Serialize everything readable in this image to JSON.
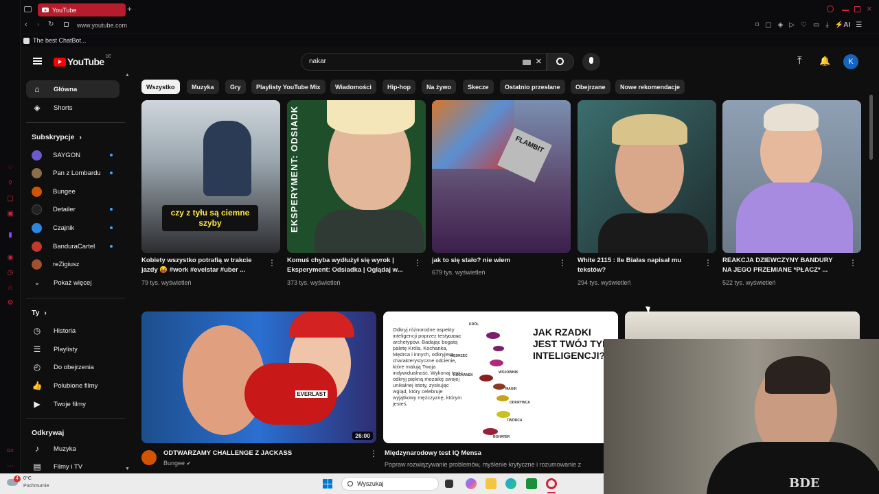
{
  "browser": {
    "tab_title": "YouTube",
    "url": "www.youtube.com",
    "bookmark": "The best ChatBot...",
    "ai_label": "AI"
  },
  "youtube": {
    "logo": "YouTube",
    "region": "DE",
    "search_value": "nakar",
    "avatar_letter": "K"
  },
  "sidebar": {
    "main": [
      {
        "label": "Główna",
        "icon": "home-icon"
      },
      {
        "label": "Shorts",
        "icon": "shorts-icon"
      }
    ],
    "subscriptions_title": "Subskrypcje",
    "subscriptions": [
      {
        "label": "SAYGON",
        "color": "#6a5acd",
        "dot": true
      },
      {
        "label": "Pan z Lombardu",
        "color": "#8b6f47",
        "dot": true
      },
      {
        "label": "Bungee",
        "color": "#d35400",
        "dot": false
      },
      {
        "label": "Detailer",
        "color": "#222222",
        "dot": true
      },
      {
        "label": "Czajnik",
        "color": "#2e86de",
        "dot": true
      },
      {
        "label": "BanduraCartel",
        "color": "#c0392b",
        "dot": true
      },
      {
        "label": "reZigiusz",
        "color": "#a0522d",
        "dot": false
      }
    ],
    "show_more": "Pokaż więcej",
    "you_title": "Ty",
    "you_items": [
      {
        "label": "Historia",
        "icon": "history-icon"
      },
      {
        "label": "Playlisty",
        "icon": "playlist-icon"
      },
      {
        "label": "Do obejrzenia",
        "icon": "watch-later-icon"
      },
      {
        "label": "Polubione filmy",
        "icon": "like-icon"
      },
      {
        "label": "Twoje filmy",
        "icon": "your-videos-icon"
      }
    ],
    "explore_title": "Odkrywaj",
    "explore_items": [
      {
        "label": "Muzyka",
        "icon": "music-icon"
      },
      {
        "label": "Filmy i TV",
        "icon": "film-icon"
      }
    ]
  },
  "chips": [
    "Wszystko",
    "Muzyka",
    "Gry",
    "Playlisty YouTube Mix",
    "Wiadomości",
    "Hip-hop",
    "Na żywo",
    "Skecze",
    "Ostatnio przesłane",
    "Obejrzane",
    "Nowe rekomendacje"
  ],
  "row1": [
    {
      "title1": "Kobiety wszystko potrafią w trakcie",
      "title2": "jazdy 😝 #work #evelstar #uber ...",
      "views": "79 tys. wyświetleń",
      "caption": "czy z tyłu są ciemne szyby"
    },
    {
      "title1": "Komuś chyba wydłużył się wyrok |",
      "title2": "Eksperyment: Odsiadka | Oglądaj w...",
      "views": "373 tys. wyświetleń",
      "caption": "EKSPERYMENT: ODSIADK"
    },
    {
      "title1": "jak to się stało? nie wiem",
      "title2": "",
      "views": "679 tys. wyświetleń",
      "caption": "FLAMBIT"
    },
    {
      "title1": "White 2115 : Ile Białas napisał mu",
      "title2": "tekstów?",
      "views": "294 tys. wyświetleń",
      "caption": ""
    },
    {
      "title1": "REAKCJA DZIEWCZYNY BANDURY",
      "title2": "NA JEGO PRZEMIANE *PŁACZ* ...",
      "views": "522 tys. wyświetleń",
      "caption": ""
    }
  ],
  "row2": [
    {
      "title": "ODTWARZAMY CHALLENGE Z JACKASS",
      "channel": "Bungee",
      "duration": "26:00",
      "glove": "EVERLAST"
    },
    {
      "title": "Międzynarodowy test IQ Mensa",
      "desc": "Popraw rozwiązywanie problemów, myślenie krytyczne i rozumowanie z",
      "headline": "JAK RZADKI JEST TWÓJ TYP INTELIGENCJI?",
      "body": "Odkryj różnorodne aspekty inteligencji poprzez testy archetypów. Badając bogatą paletę Króla, Kochanka, Mędrca i innych, odkryjesz charakterystyczne odcienie, które malują Twoja indywidualność. Wykonaj test i odkryj piękną mozaikę swojej unikalnej istoty, zyskując wgląd, który celebruje wyjątkowy mężczyznę, którym jesteś.",
      "archetypes": [
        "KRÓL",
        "OJCIEC",
        "MĘDRZEC",
        "KOCHANEK",
        "WOJOWNIK",
        "MAGIK",
        "ODKRYWCA",
        "TWÓRCA",
        "BOHATER"
      ]
    }
  ],
  "webcam_shirt": "BDE",
  "taskbar": {
    "weather_temp": "0°C",
    "weather_desc": "Pochmurnie",
    "notif": "4",
    "search_placeholder": "Wyszukaj"
  },
  "colors": {
    "accent": "#ff0000",
    "opera": "#c8283e",
    "link": "#3ea6ff"
  }
}
